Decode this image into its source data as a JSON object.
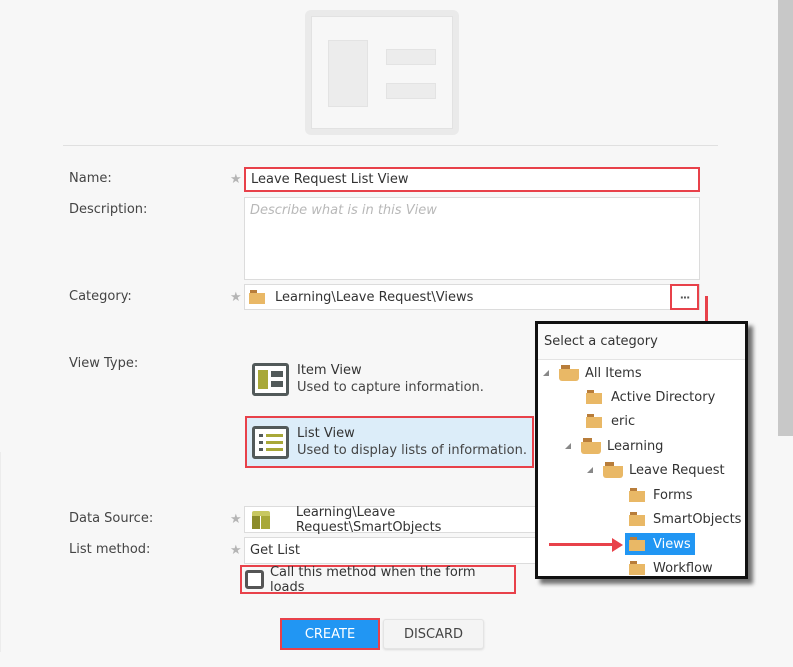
{
  "thumbnail": {
    "icon": "view-layout-thumbnail-icon"
  },
  "form": {
    "name": {
      "label": "Name:",
      "value": "Leave Request List View",
      "required": true
    },
    "description": {
      "label": "Description:",
      "value": "",
      "placeholder": "Describe what is in this View"
    },
    "category": {
      "label": "Category:",
      "value": "Learning\\Leave Request\\Views",
      "required": true,
      "icon": "folder-icon",
      "browse_label": "···"
    },
    "view_type": {
      "label": "View Type:",
      "options": [
        {
          "title": "Item View",
          "description": "Used to capture information.",
          "icon": "item-view-icon",
          "selected": false
        },
        {
          "title": "List View",
          "description": "Used to display lists of information.",
          "icon": "list-view-icon",
          "selected": true
        }
      ]
    },
    "data_source": {
      "label": "Data Source:",
      "value": "Learning\\Leave Request\\SmartObjects",
      "required": true,
      "icon": "smartobject-cube-icon"
    },
    "list_method": {
      "label": "List method:",
      "value": "Get List",
      "required": true
    },
    "call_on_load": {
      "label": "Call this method when the form loads",
      "checked": false
    },
    "required_marker": "★"
  },
  "buttons": {
    "create": "CREATE",
    "discard": "DISCARD"
  },
  "category_popup": {
    "title": "Select a category",
    "tree": [
      {
        "label": "All Items",
        "level": 0,
        "expanded": true,
        "selected": false
      },
      {
        "label": "Active Directory",
        "level": 1,
        "expanded": false,
        "selected": false
      },
      {
        "label": "eric",
        "level": 1,
        "expanded": false,
        "selected": false
      },
      {
        "label": "Learning",
        "level": 1,
        "expanded": true,
        "selected": false
      },
      {
        "label": "Leave Request",
        "level": 2,
        "expanded": true,
        "selected": false
      },
      {
        "label": "Forms",
        "level": 3,
        "expanded": false,
        "selected": false
      },
      {
        "label": "SmartObjects",
        "level": 3,
        "expanded": false,
        "selected": false
      },
      {
        "label": "Views",
        "level": 3,
        "expanded": false,
        "selected": true
      },
      {
        "label": "Workflow",
        "level": 3,
        "expanded": false,
        "selected": false
      }
    ]
  },
  "colors": {
    "accent": "#2196f3",
    "highlight": "#e8414a",
    "folder": "#e9b866",
    "view_icon": "#a8a838",
    "selected_row_bg": "#dcedf9"
  }
}
